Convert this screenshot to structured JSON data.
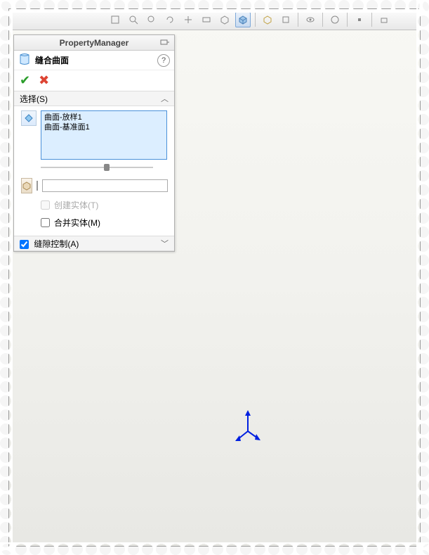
{
  "toolbar": {
    "buttons": [
      {
        "name": "zoom-fit-icon"
      },
      {
        "name": "zoom-area-icon"
      },
      {
        "name": "zoom-icon"
      },
      {
        "name": "rotate-icon"
      },
      {
        "name": "pan-icon"
      },
      {
        "name": "section-icon"
      },
      {
        "name": "display-style-icon"
      },
      {
        "name": "cube-icon",
        "active": true
      },
      {
        "name": "scene-icon"
      },
      {
        "name": "view-orient-icon"
      },
      {
        "name": "hide-show-icon"
      },
      {
        "name": "appearance-icon"
      },
      {
        "name": "settings-icon"
      },
      {
        "name": "capture-icon"
      }
    ]
  },
  "property_manager": {
    "title": "PropertyManager",
    "feature_name": "缝合曲面",
    "help_label": "?"
  },
  "select_section": {
    "header": "选择(S)",
    "items": [
      "曲面-放样1",
      "曲面-基准面1"
    ]
  },
  "options": {
    "create_solid": {
      "label": "创建实体(T)",
      "checked": false,
      "disabled": true
    },
    "merge_entities": {
      "label": "合并实体(M)",
      "checked": false
    }
  },
  "gap_section": {
    "header": "缝隙控制(A)",
    "checked": true
  },
  "colors": {
    "swatch": "#ff99c8",
    "model_fill": "#5aa8d8"
  }
}
